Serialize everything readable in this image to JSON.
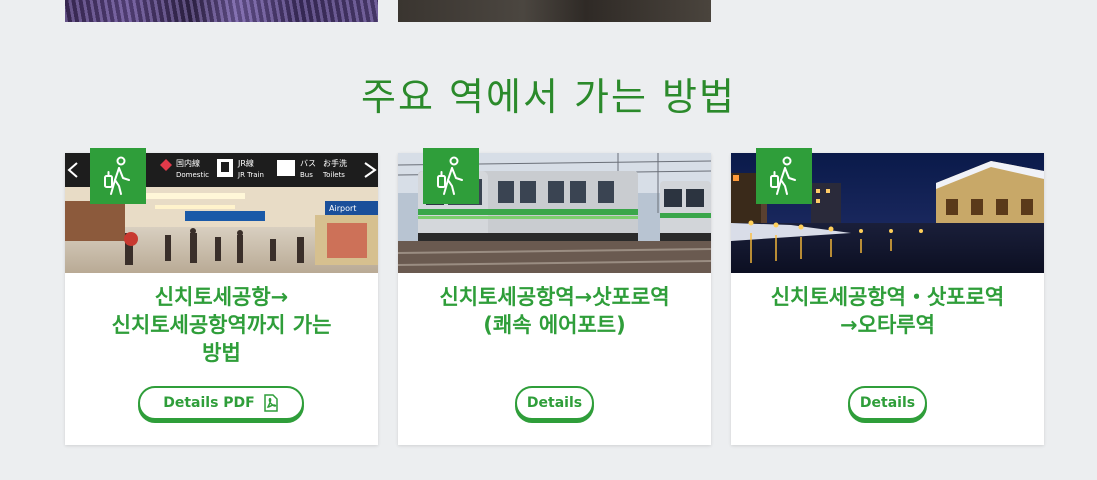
{
  "section": {
    "title": "주요 역에서 가는 방법"
  },
  "cards": [
    {
      "title_lines": [
        "신치토세공항→",
        "신치토세공항역까지 가는",
        "방법"
      ],
      "button_label": "Details PDF",
      "button_icon": "pdf-icon",
      "badge_icon": "walking-traveler-icon",
      "photo": "airport-concourse-photo",
      "signs": [
        "国内線",
        "Domestic",
        "JR線",
        "JR Train",
        "バス",
        "Bus",
        "お手洗",
        "Toilets",
        "Airport"
      ]
    },
    {
      "title_lines": [
        "신치토세공항역→삿포로역",
        "(쾌속 에어포트)"
      ],
      "button_label": "Details",
      "badge_icon": "walking-traveler-icon",
      "photo": "green-striped-train-photo"
    },
    {
      "title_lines": [
        "신치토세공항역・삿포로역",
        "→오타루역"
      ],
      "button_label": "Details",
      "badge_icon": "walking-traveler-icon",
      "photo": "otaru-canal-night-photo"
    }
  ],
  "colors": {
    "accent": "#2f9e3a",
    "title": "#2b8a2b",
    "background": "#eceef0"
  }
}
